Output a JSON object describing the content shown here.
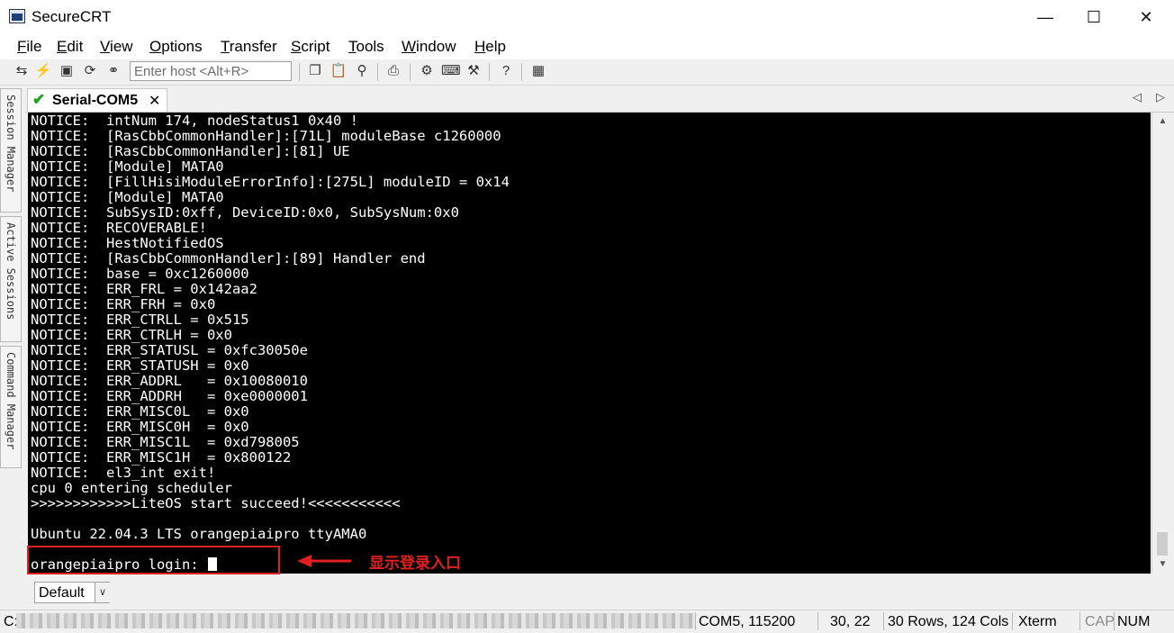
{
  "window": {
    "title": "SecureCRT",
    "minimize": "—",
    "maximize": "☐",
    "close": "✕"
  },
  "menu": [
    "File",
    "Edit",
    "View",
    "Options",
    "Transfer",
    "Script",
    "Tools",
    "Window",
    "Help"
  ],
  "toolbar": {
    "host_placeholder": "Enter host <Alt+R>"
  },
  "side_tabs": [
    "Session Manager",
    "Active Sessions",
    "Command Manager"
  ],
  "tab": {
    "label": "Serial-COM5",
    "close": "✕",
    "status_icon": "check-icon"
  },
  "terminal": {
    "lines": [
      "NOTICE:  intNum 174, nodeStatus1 0x40 !",
      "NOTICE:  [RasCbbCommonHandler]:[71L] moduleBase c1260000",
      "NOTICE:  [RasCbbCommonHandler]:[81] UE",
      "NOTICE:  [Module] MATA0",
      "NOTICE:  [FillHisiModuleErrorInfo]:[275L] moduleID = 0x14",
      "NOTICE:  [Module] MATA0",
      "NOTICE:  SubSysID:0xff, DeviceID:0x0, SubSysNum:0x0",
      "NOTICE:  RECOVERABLE!",
      "NOTICE:  HestNotifiedOS",
      "NOTICE:  [RasCbbCommonHandler]:[89] Handler end",
      "NOTICE:  base = 0xc1260000",
      "NOTICE:  ERR_FRL = 0x142aa2",
      "NOTICE:  ERR_FRH = 0x0",
      "NOTICE:  ERR_CTRLL = 0x515",
      "NOTICE:  ERR_CTRLH = 0x0",
      "NOTICE:  ERR_STATUSL = 0xfc30050e",
      "NOTICE:  ERR_STATUSH = 0x0",
      "NOTICE:  ERR_ADDRL   = 0x10080010",
      "NOTICE:  ERR_ADDRH   = 0xe0000001",
      "NOTICE:  ERR_MISC0L  = 0x0",
      "NOTICE:  ERR_MISC0H  = 0x0",
      "NOTICE:  ERR_MISC1L  = 0xd798005",
      "NOTICE:  ERR_MISC1H  = 0x800122",
      "NOTICE:  el3_int exit!",
      "cpu 0 entering scheduler",
      ">>>>>>>>>>>>LiteOS start succeed!<<<<<<<<<<<",
      "",
      "Ubuntu 22.04.3 LTS orangepiaipro ttyAMA0",
      "",
      "orangepiaipro login: "
    ]
  },
  "annotation": {
    "text": "显示登录入口",
    "color": "#e02020"
  },
  "button_bar": {
    "selected": "Default"
  },
  "status_bar": {
    "prefix": "C:\\",
    "port": "COM5, 115200",
    "cursor_pos": "30,  22",
    "size": "30 Rows, 124 Cols",
    "emulation": "Xterm",
    "caps": "CAP",
    "num": "NUM"
  },
  "colors": {
    "terminal_bg": "#000000",
    "terminal_fg": "#ffffff",
    "connected": "#1aa31a"
  }
}
